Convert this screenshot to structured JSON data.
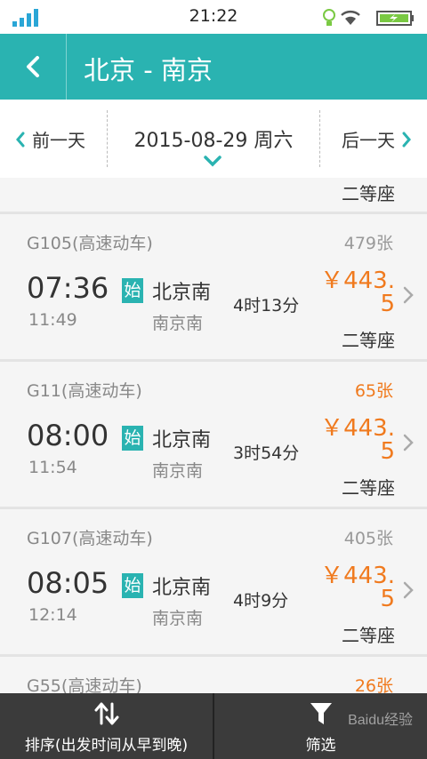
{
  "status": {
    "time": "21:22"
  },
  "header": {
    "title": "北京 - 南京"
  },
  "datebar": {
    "prev_label": "前一天",
    "current_date": "2015-08-29 周六",
    "next_label": "后一天"
  },
  "partial_top": {
    "seat_type": "二等座"
  },
  "trains": [
    {
      "number": "G105(高速动车)",
      "seats_left": "479张",
      "seats_low": false,
      "depart": "07:36",
      "arrive": "11:49",
      "origin_badge": "始",
      "from": "北京南",
      "to": "南京南",
      "duration": "4时13分",
      "price_line1": "￥443.",
      "price_line2": "5",
      "seat_type": "二等座"
    },
    {
      "number": "G11(高速动车)",
      "seats_left": "65张",
      "seats_low": true,
      "depart": "08:00",
      "arrive": "11:54",
      "origin_badge": "始",
      "from": "北京南",
      "to": "南京南",
      "duration": "3时54分",
      "price_line1": "￥443.",
      "price_line2": "5",
      "seat_type": "二等座"
    },
    {
      "number": "G107(高速动车)",
      "seats_left": "405张",
      "seats_low": false,
      "depart": "08:05",
      "arrive": "12:14",
      "origin_badge": "始",
      "from": "北京南",
      "to": "南京南",
      "duration": "4时9分",
      "price_line1": "￥443.",
      "price_line2": "5",
      "seat_type": "二等座"
    }
  ],
  "partial_bottom": {
    "number": "G55(高速动车)",
    "seats_left": "26张"
  },
  "bottombar": {
    "sort_label": "排序(出发时间从早到晚)",
    "filter_label": "筛选"
  },
  "watermark": "Baidu经验",
  "colors": {
    "accent": "#2ab3b1",
    "price": "#f07a1e",
    "low_seats": "#f07a1e"
  }
}
